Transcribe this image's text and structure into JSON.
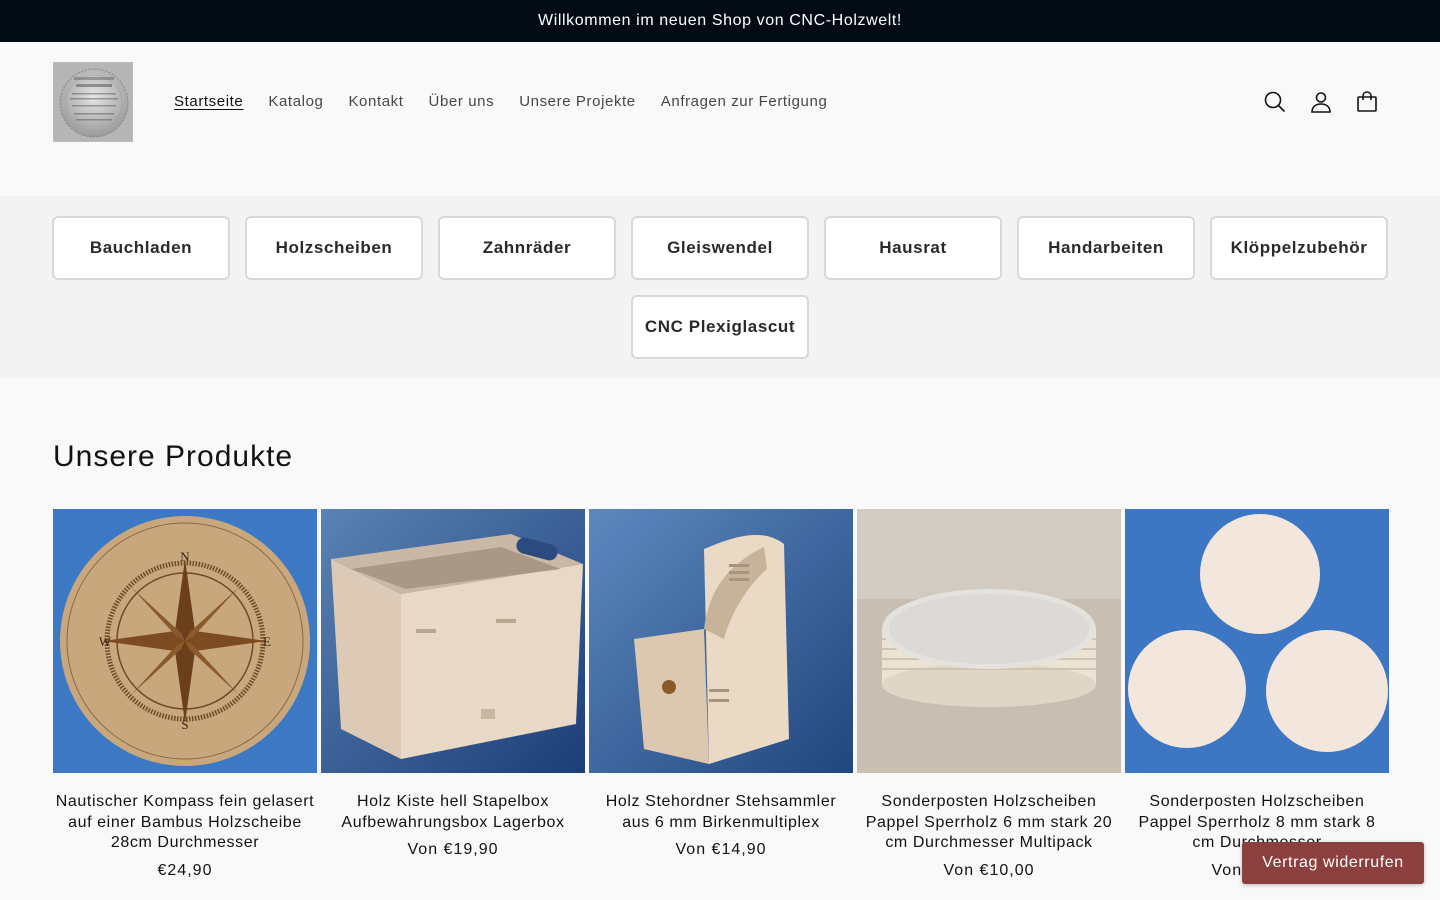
{
  "announcement": {
    "text": "Willkommen im neuen Shop von CNC-Holzwelt!"
  },
  "header": {
    "nav": [
      {
        "label": "Startseite",
        "active": true
      },
      {
        "label": "Katalog",
        "active": false
      },
      {
        "label": "Kontakt",
        "active": false
      },
      {
        "label": "Über uns",
        "active": false
      },
      {
        "label": "Unsere Projekte",
        "active": false
      },
      {
        "label": "Anfragen zur Fertigung",
        "active": false
      }
    ],
    "icons": [
      "search-icon",
      "account-icon",
      "cart-icon"
    ]
  },
  "categories": {
    "row1": [
      "Bauchladen",
      "Holzscheiben",
      "Zahnräder",
      "Gleiswendel",
      "Hausrat",
      "Handarbeiten",
      "Klöppelzubehör"
    ],
    "row2": [
      "CNC Plexiglascut"
    ]
  },
  "products": {
    "heading": "Unsere Produkte",
    "items": [
      {
        "title": "Nautischer Kompass fein gelasert auf einer Bambus Holzscheibe 28cm Durchmesser",
        "price": "€24,90"
      },
      {
        "title": "Holz Kiste hell Stapelbox Aufbewahrungsbox Lagerbox",
        "price": "Von €19,90"
      },
      {
        "title": "Holz Stehordner Stehsammler aus 6 mm Birkenmultiplex",
        "price": "Von €14,90"
      },
      {
        "title": "Sonderposten Holzscheiben Pappel Sperrholz 6 mm stark 20 cm Durchmesser Multipack",
        "price": "Von €10,00"
      },
      {
        "title": "Sonderposten Holzscheiben Pappel Sperrholz 8 mm stark 8 cm Durchmesser",
        "price": "Von €10,00"
      }
    ]
  },
  "revoke_button": {
    "label": "Vertrag widerrufen"
  },
  "colors": {
    "announcement_bg": "#020a14",
    "revoke_bg": "#8c3f3f",
    "category_bg": "#f3f3f3"
  }
}
